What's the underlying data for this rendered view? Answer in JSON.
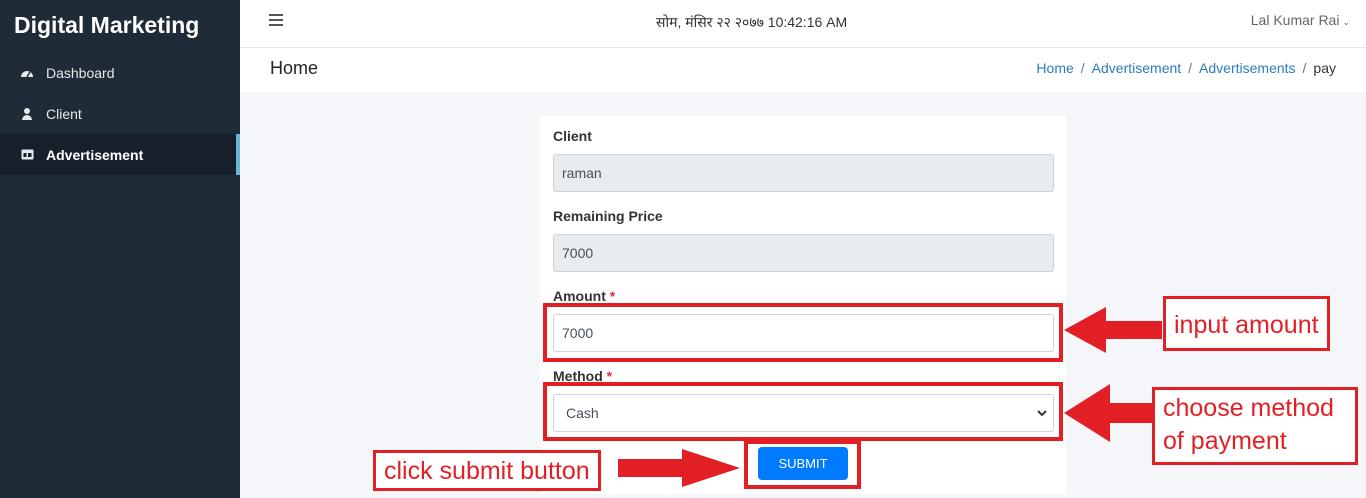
{
  "sidebar": {
    "brand": "Digital Marketing",
    "items": [
      {
        "label": "Dashboard",
        "icon": "dashboard-icon"
      },
      {
        "label": "Client",
        "icon": "user-icon"
      },
      {
        "label": "Advertisement",
        "icon": "ad-icon",
        "active": true
      }
    ]
  },
  "topbar": {
    "datetime": "सोम, मंसिर २२ २०७७ 10:42:16 AM",
    "user": "Lal Kumar Rai"
  },
  "header": {
    "title": "Home",
    "breadcrumb": [
      "Home",
      "Advertisement",
      "Advertisements",
      "pay"
    ]
  },
  "form": {
    "client_label": "Client",
    "client_value": "raman",
    "remaining_label": "Remaining Price",
    "remaining_value": "7000",
    "amount_label": "Amount",
    "amount_value": "7000",
    "method_label": "Method",
    "method_value": "Cash",
    "required_mark": "*",
    "submit_label": "SUBMIT"
  },
  "annotations": {
    "amount": "input amount",
    "method_line1": "choose method",
    "method_line2": "of payment",
    "submit": "click submit button"
  },
  "colors": {
    "sidebar_bg": "#1f2b36",
    "accent": "#007bff",
    "annotation": "#e31f26"
  }
}
